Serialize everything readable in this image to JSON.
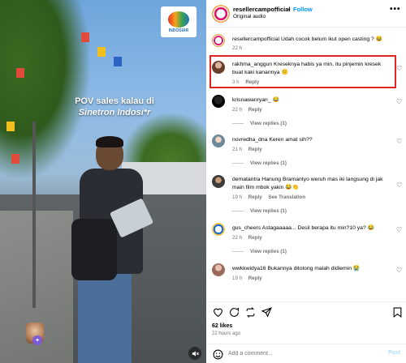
{
  "video": {
    "logo_text": "INDOSIAR",
    "caption_line1": "POV sales kalau di",
    "caption_line2": "Sinetron Indosi*r",
    "mute_icon": "speaker-muted-icon"
  },
  "header": {
    "username": "resellercampofficial",
    "dot": "•",
    "follow_label": "Follow",
    "subtitle": "Original audio",
    "more_icon": "•••"
  },
  "comments": [
    {
      "user": "resellercampofficial",
      "text": "Udah cocok belum ikut open casting ? 😆",
      "time": "22 h",
      "reply": "",
      "extra": "",
      "view_replies": ""
    },
    {
      "user": "rakhma_anggun",
      "text": "Kreseknya habis ya min, itu pinjemin kresek buat kaki kanannya 😕",
      "time": "3 h",
      "reply": "Reply",
      "extra": "",
      "view_replies": ""
    },
    {
      "user": "krisnawanryan_",
      "text": "😂",
      "time": "22 h",
      "reply": "Reply",
      "extra": "",
      "view_replies": "View replies (1)"
    },
    {
      "user": "novredha_dna",
      "text": "Keren amat sih??",
      "time": "21 h",
      "reply": "Reply",
      "extra": "",
      "view_replies": "View replies (1)"
    },
    {
      "user": "dematantra",
      "text": "Hanung Bramantyo weruh mas iki langsung di jak main film mbok yakin 😂👏",
      "time": "19 h",
      "reply": "Reply",
      "extra": "See Translation",
      "view_replies": "View replies (1)"
    },
    {
      "user": "gus_cheers",
      "text": "Astagaaaaa... Desil berapa itu min?10 ya? 😂",
      "time": "22 h",
      "reply": "Reply",
      "extra": "",
      "view_replies": "View replies (1)"
    },
    {
      "user": "wwkkwidya16",
      "text": "Bukannya ditolong malah didiemin 😭",
      "time": "19 h",
      "reply": "Reply",
      "extra": "",
      "view_replies": ""
    }
  ],
  "footer": {
    "likes": "62 likes",
    "time_ago": "22 hours ago",
    "add_comment_placeholder": "Add a comment...",
    "post_label": "Post"
  },
  "colors": {
    "accent": "#0095f6",
    "highlight": "#e0241f"
  }
}
